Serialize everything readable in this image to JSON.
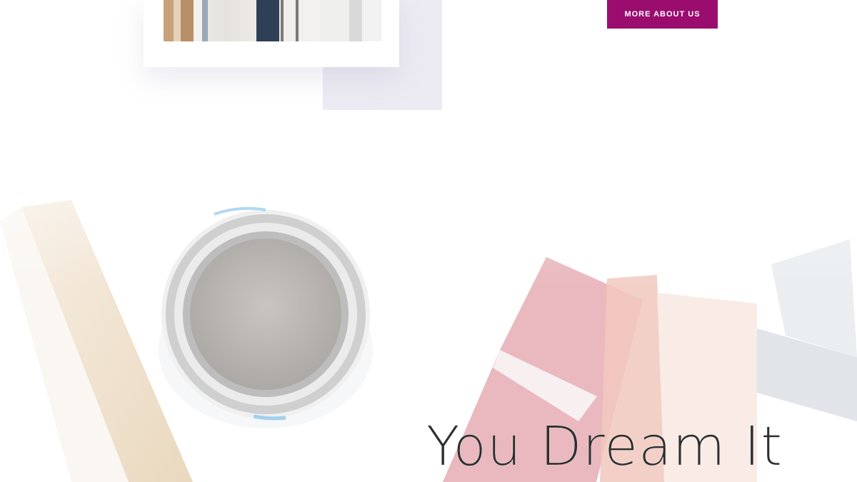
{
  "about": {
    "button_label": "MORE ABOUT US",
    "accent_color": "#9a0d6e"
  },
  "hero": {
    "title": "You Dream It"
  },
  "icons": {
    "photo": "painter-on-ladder-photo",
    "paint_can": "paint-can-image",
    "swatches": "color-swatch-cards-image",
    "tape": "masking-tape-image"
  }
}
